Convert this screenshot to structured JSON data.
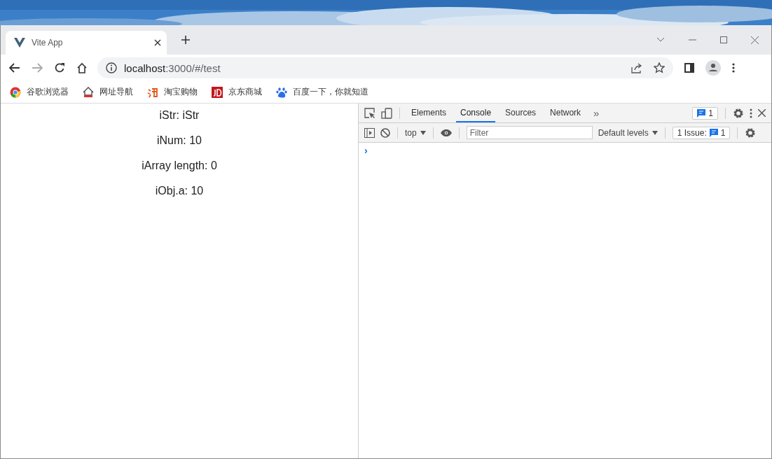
{
  "tabs": [
    {
      "title": "Vite App",
      "selected": true
    }
  ],
  "address": {
    "host": "localhost",
    "rest": ":3000/#/test"
  },
  "bookmarks": [
    {
      "label": "谷歌浏览器",
      "kind": "chrome"
    },
    {
      "label": "网址导航",
      "kind": "house"
    },
    {
      "label": "淘宝购物",
      "kind": "taobao"
    },
    {
      "label": "京东商城",
      "kind": "jd"
    },
    {
      "label": "百度一下，你就知道",
      "kind": "paw"
    }
  ],
  "page": {
    "lines": [
      "iStr: iStr",
      "iNum: 10",
      "iArray length: 0",
      "iObj.a: 10"
    ]
  },
  "devtools": {
    "tabs": [
      {
        "label": "Elements",
        "selected": false
      },
      {
        "label": "Console",
        "selected": true
      },
      {
        "label": "Sources",
        "selected": false
      },
      {
        "label": "Network",
        "selected": false
      }
    ],
    "more": "»",
    "message_count": "1",
    "context": "top",
    "filter": {
      "placeholder": "Filter"
    },
    "levels": "Default levels",
    "issues_label": "1 Issue:",
    "issues_count": "1",
    "prompt": "›"
  }
}
